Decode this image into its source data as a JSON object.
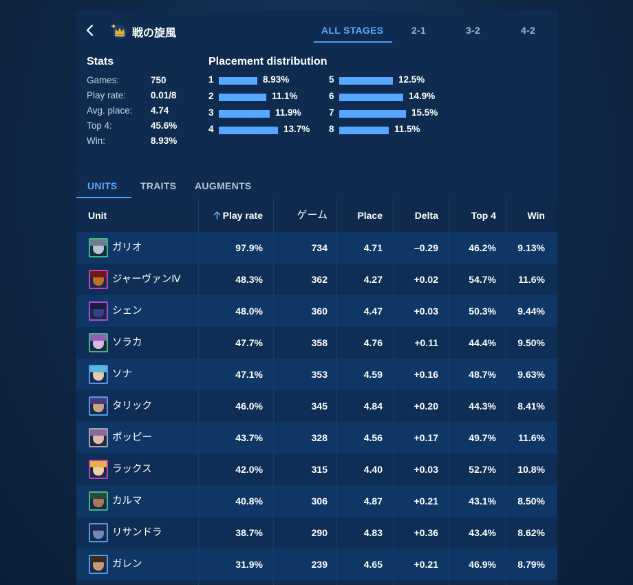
{
  "header": {
    "title": "戦の旋風",
    "back_icon": "chevron-left-icon",
    "logo_icon": "crown-icon",
    "stage_tabs": [
      {
        "label": "ALL STAGES",
        "active": true
      },
      {
        "label": "2-1",
        "active": false
      },
      {
        "label": "3-2",
        "active": false
      },
      {
        "label": "4-2",
        "active": false
      }
    ]
  },
  "stats": {
    "title": "Stats",
    "rows": [
      {
        "label": "Games:",
        "value": "750"
      },
      {
        "label": "Play rate:",
        "value": "0.01/8"
      },
      {
        "label": "Avg. place:",
        "value": "4.74"
      },
      {
        "label": "Top 4:",
        "value": "45.6%"
      },
      {
        "label": "Win:",
        "value": "8.93%"
      }
    ]
  },
  "distribution": {
    "title": "Placement distribution",
    "bar_color": "#57a6ff",
    "items": [
      {
        "place": "1",
        "pct": "8.93%",
        "value": 8.93
      },
      {
        "place": "2",
        "pct": "11.1%",
        "value": 11.1
      },
      {
        "place": "3",
        "pct": "11.9%",
        "value": 11.9
      },
      {
        "place": "4",
        "pct": "13.7%",
        "value": 13.7
      },
      {
        "place": "5",
        "pct": "12.5%",
        "value": 12.5
      },
      {
        "place": "6",
        "pct": "14.9%",
        "value": 14.9
      },
      {
        "place": "7",
        "pct": "15.5%",
        "value": 15.5
      },
      {
        "place": "8",
        "pct": "11.5%",
        "value": 11.5
      }
    ]
  },
  "section_tabs": [
    {
      "label": "UNITS",
      "active": true
    },
    {
      "label": "TRAITS",
      "active": false
    },
    {
      "label": "AUGMENTS",
      "active": false
    }
  ],
  "table": {
    "sort_icon": "arrow-up-icon",
    "columns": [
      "Unit",
      "Play rate",
      "ゲーム",
      "Place",
      "Delta",
      "Top 4",
      "Win"
    ],
    "rows": [
      {
        "name": "ガリオ",
        "play_rate": "97.9%",
        "games": "734",
        "place": "4.71",
        "delta": "–0.29",
        "top4": "46.2%",
        "win": "9.13%",
        "border": "#3fb98a",
        "face": "#b9c4cc",
        "hair": "#6b7f8e"
      },
      {
        "name": "ジャーヴァンⅣ",
        "play_rate": "48.3%",
        "games": "362",
        "place": "4.27",
        "delta": "+0.02",
        "top4": "54.7%",
        "win": "11.6%",
        "border": "#c23fc0",
        "face": "#c46a2a",
        "hair": "#6b1d14"
      },
      {
        "name": "シェン",
        "play_rate": "48.0%",
        "games": "360",
        "place": "4.47",
        "delta": "+0.03",
        "top4": "50.3%",
        "win": "9.44%",
        "border": "#b14be0",
        "face": "#3a3f8a",
        "hair": "#1a1c40"
      },
      {
        "name": "ソラカ",
        "play_rate": "47.7%",
        "games": "358",
        "place": "4.76",
        "delta": "+0.11",
        "top4": "44.4%",
        "win": "9.50%",
        "border": "#3fb98a",
        "face": "#d9b7e0",
        "hair": "#8f5fb8"
      },
      {
        "name": "ソナ",
        "play_rate": "47.1%",
        "games": "353",
        "place": "4.59",
        "delta": "+0.16",
        "top4": "48.7%",
        "win": "9.63%",
        "border": "#4d9cf5",
        "face": "#e2c9b8",
        "hair": "#5ab8d8"
      },
      {
        "name": "タリック",
        "play_rate": "46.0%",
        "games": "345",
        "place": "4.84",
        "delta": "+0.20",
        "top4": "44.3%",
        "win": "8.41%",
        "border": "#4d9cf5",
        "face": "#c9a38a",
        "hair": "#4a3a78"
      },
      {
        "name": "ポッピー",
        "play_rate": "43.7%",
        "games": "328",
        "place": "4.56",
        "delta": "+0.17",
        "top4": "49.7%",
        "win": "11.6%",
        "border": "#a0a7b3",
        "face": "#e2b8a8",
        "hair": "#8b6a9c"
      },
      {
        "name": "ラックス",
        "play_rate": "42.0%",
        "games": "315",
        "place": "4.40",
        "delta": "+0.03",
        "top4": "52.7%",
        "win": "10.8%",
        "border": "#c23fc0",
        "face": "#f0cfa8",
        "hair": "#e8b040"
      },
      {
        "name": "カルマ",
        "play_rate": "40.8%",
        "games": "306",
        "place": "4.87",
        "delta": "+0.21",
        "top4": "43.1%",
        "win": "8.50%",
        "border": "#3fb98a",
        "face": "#a87a5a",
        "hair": "#2a4a3a"
      },
      {
        "name": "リサンドラ",
        "play_rate": "38.7%",
        "games": "290",
        "place": "4.83",
        "delta": "+0.36",
        "top4": "43.4%",
        "win": "8.62%",
        "border": "#4d9cf5",
        "face": "#6a8ab8",
        "hair": "#1e2a50"
      },
      {
        "name": "ガレン",
        "play_rate": "31.9%",
        "games": "239",
        "place": "4.65",
        "delta": "+0.21",
        "top4": "46.9%",
        "win": "8.79%",
        "border": "#4d9cf5",
        "face": "#c99a7a",
        "hair": "#3a2a20"
      }
    ]
  }
}
